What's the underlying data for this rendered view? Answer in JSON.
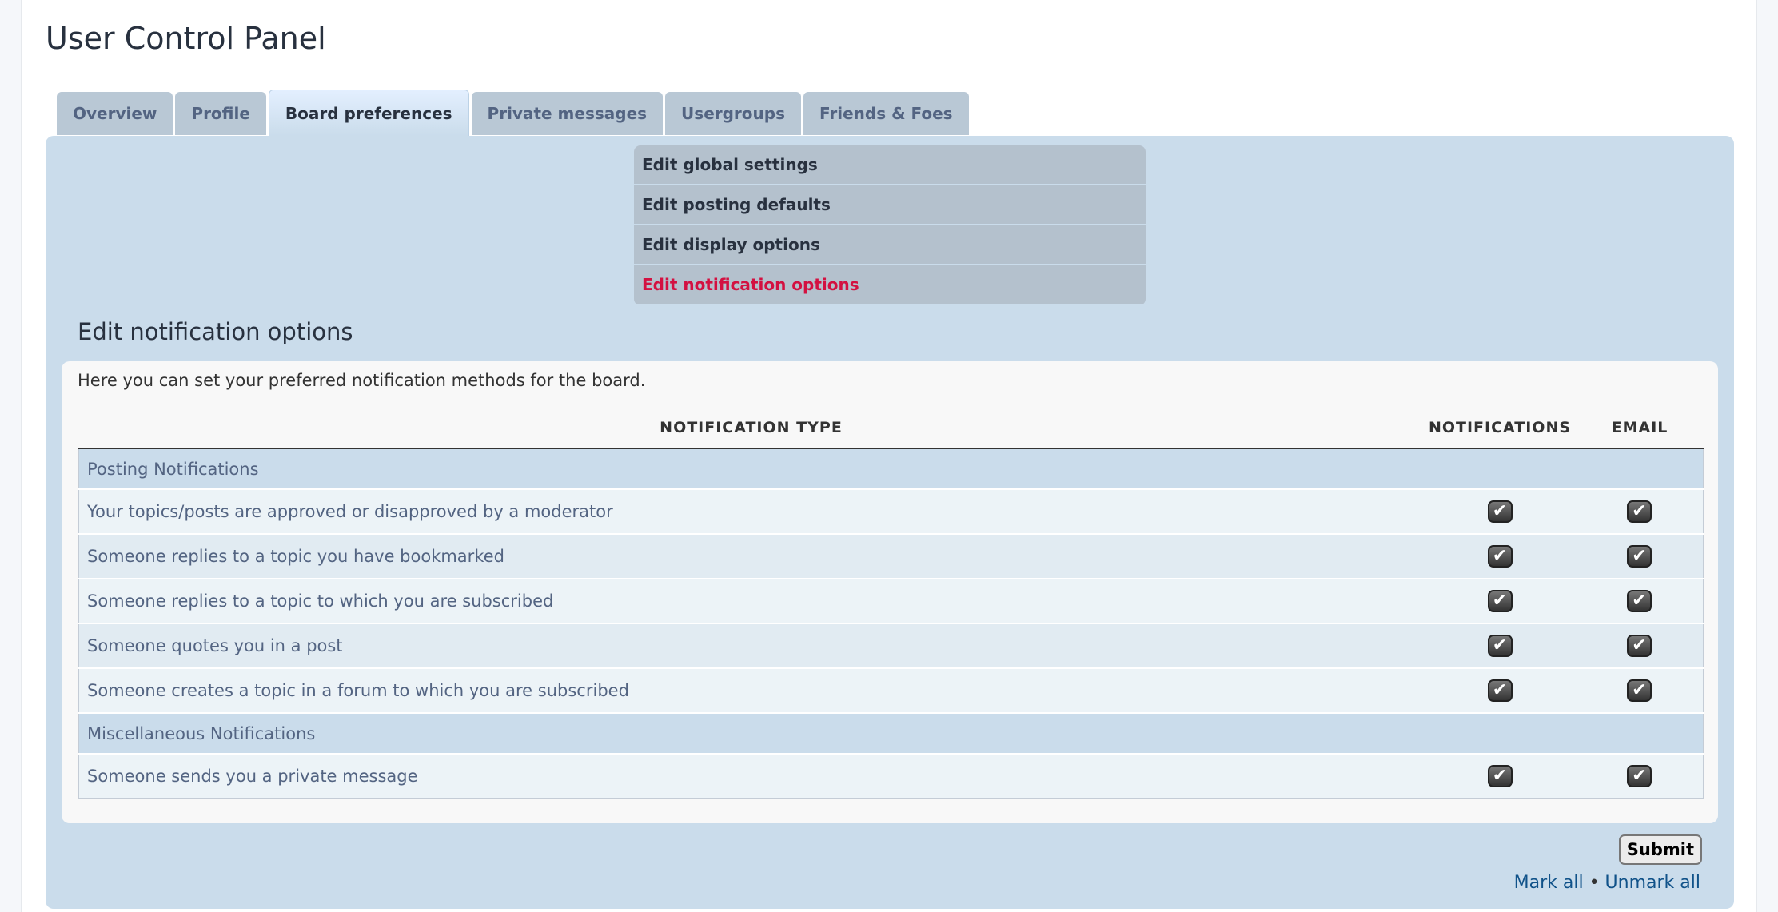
{
  "title": "User Control Panel",
  "tabs": [
    "Overview",
    "Profile",
    "Board preferences",
    "Private messages",
    "Usergroups",
    "Friends & Foes"
  ],
  "active_tab": "Board preferences",
  "submenu": [
    "Edit global settings",
    "Edit posting defaults",
    "Edit display options",
    "Edit notification options"
  ],
  "active_submenu": "Edit notification options",
  "heading": "Edit notification options",
  "intro": "Here you can set your preferred notification methods for the board.",
  "table": {
    "headers": [
      "NOTIFICATION TYPE",
      "NOTIFICATIONS",
      "EMAIL"
    ],
    "sections": [
      {
        "name": "Posting Notifications",
        "rows": [
          {
            "label": "Your topics/posts are approved or disapproved by a moderator",
            "notifications": true,
            "email": true
          },
          {
            "label": "Someone replies to a topic you have bookmarked",
            "notifications": true,
            "email": true
          },
          {
            "label": "Someone replies to a topic to which you are subscribed",
            "notifications": true,
            "email": true
          },
          {
            "label": "Someone quotes you in a post",
            "notifications": true,
            "email": true
          },
          {
            "label": "Someone creates a topic in a forum to which you are subscribed",
            "notifications": true,
            "email": true
          }
        ]
      },
      {
        "name": "Miscellaneous Notifications",
        "rows": [
          {
            "label": "Someone sends you a private message",
            "notifications": true,
            "email": true
          }
        ]
      }
    ]
  },
  "submit_label": "Submit",
  "mark_all": "Mark all",
  "separator": "•",
  "unmark_all": "Unmark all",
  "colors": {
    "panel": "#cadceb",
    "active_link": "#d31141",
    "link": "#105289"
  }
}
